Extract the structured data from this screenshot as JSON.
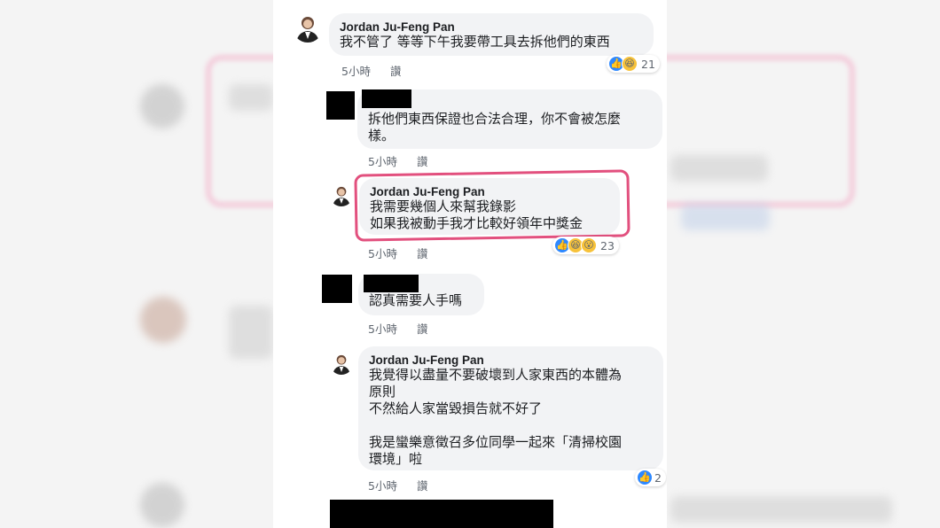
{
  "comments": [
    {
      "author": "Jordan Ju-Feng Pan",
      "text": "我不管了 等等下午我要帶工具去拆他們的東西",
      "time": "5小時",
      "action": "讚",
      "reactions": [
        "like-icon",
        "haha-icon"
      ],
      "reaction_count": "21"
    },
    {
      "author": "",
      "text": "拆他們東西保證也合法合理，你不會被怎麼\n樣。",
      "time": "5小時",
      "action": "讚"
    },
    {
      "author": "Jordan Ju-Feng Pan",
      "text": "我需要幾個人來幫我錄影\n如果我被動手我才比較好領年中獎金",
      "time": "5小時",
      "action": "讚",
      "reactions": [
        "like-icon",
        "haha-icon",
        "wow-icon"
      ],
      "reaction_count": "23"
    },
    {
      "author": "",
      "text": "認真需要人手嗎",
      "time": "5小時",
      "action": "讚"
    },
    {
      "author": "Jordan Ju-Feng Pan",
      "text": "我覺得以盡量不要破壞到人家東西的本體為\n原則\n不然給人家當毀損告就不好了\n\n我是蠻樂意徵召多位同學一起來「清掃校園\n環境」啦",
      "time": "5小時",
      "action": "讚",
      "reactions": [
        "like-icon"
      ],
      "reaction_count": "2"
    }
  ],
  "colors": {
    "highlight": "#e2507e",
    "bubble": "#f2f3f5",
    "like": "#2d88ff"
  }
}
